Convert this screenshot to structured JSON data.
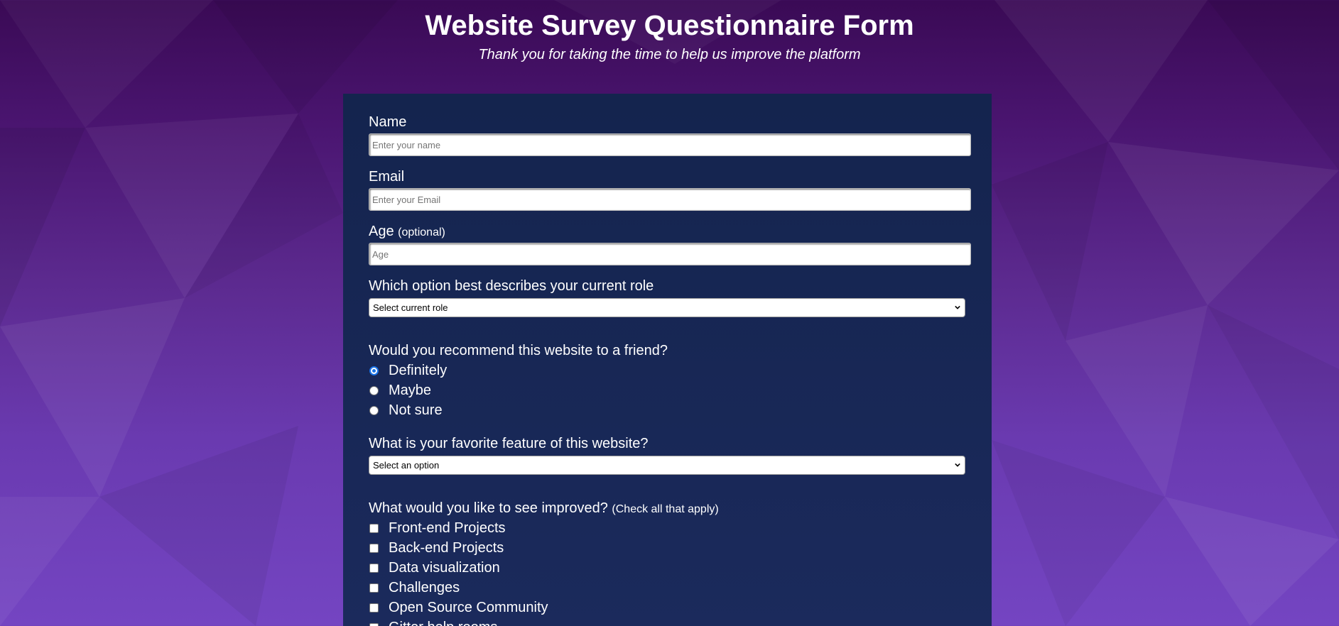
{
  "header": {
    "title": "Website Survey Questionnaire Form",
    "description": "Thank you for taking the time to help us improve the platform"
  },
  "form": {
    "name": {
      "label": "Name",
      "placeholder": "Enter your name",
      "value": ""
    },
    "email": {
      "label": "Email",
      "placeholder": "Enter your Email",
      "value": ""
    },
    "age": {
      "label": "Age",
      "label_note": "(optional)",
      "placeholder": "Age",
      "value": ""
    },
    "role": {
      "label": "Which option best describes your current role",
      "selected": "Select current role"
    },
    "recommend": {
      "label": "Would you recommend this website to a friend?",
      "options": [
        {
          "label": "Definitely",
          "checked": true
        },
        {
          "label": "Maybe",
          "checked": false
        },
        {
          "label": "Not sure",
          "checked": false
        }
      ]
    },
    "favorite_feature": {
      "label": "What is your favorite feature of this website?",
      "selected": "Select an option"
    },
    "improvements": {
      "label": "What would you like to see improved?",
      "label_note": "(Check all that apply)",
      "options": [
        {
          "label": "Front-end Projects",
          "checked": false
        },
        {
          "label": "Back-end Projects",
          "checked": false
        },
        {
          "label": "Data visualization",
          "checked": false
        },
        {
          "label": "Challenges",
          "checked": false
        },
        {
          "label": "Open Source Community",
          "checked": false
        },
        {
          "label": "Gitter help rooms",
          "checked": false
        }
      ]
    }
  },
  "colors": {
    "background_top": "#3a0a55",
    "background_bottom": "#7445c2",
    "panel": "#1b2a5c",
    "radio_accent": "#1a73e8"
  },
  "icons": {
    "select_arrow": "chevron-down-icon"
  }
}
